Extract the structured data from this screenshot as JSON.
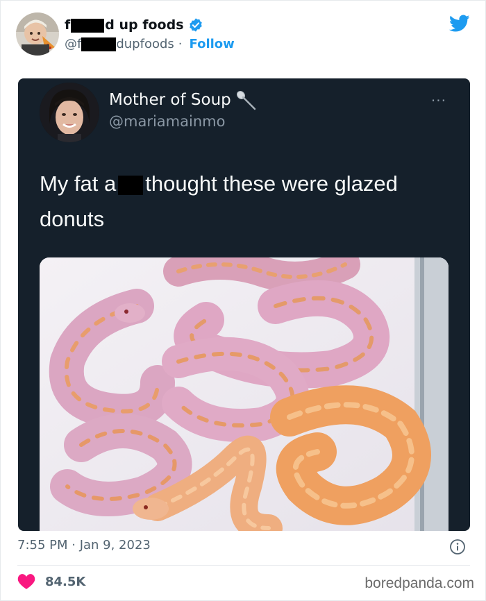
{
  "tweet": {
    "author_prefix": "f",
    "author_suffix": "d up foods",
    "handle_prefix": "@f",
    "handle_suffix": "dupfoods",
    "separator": "·",
    "follow_label": "Follow",
    "timestamp": "7:55 PM · Jan 9, 2023",
    "like_count": "84.5K",
    "brand_color": "#1d9bf0"
  },
  "embedded_tweet": {
    "display_name": "Mother of Soup",
    "name_emoji_icon": "spoon-icon",
    "handle": "@mariamainmo",
    "more_label": "···",
    "text_before": "My fat a",
    "text_after": "thought these were glazed donuts",
    "background_color": "#15202b",
    "photo_description_icon": "pink-and-orange-snakes-photo"
  },
  "watermark": "boredpanda.com"
}
